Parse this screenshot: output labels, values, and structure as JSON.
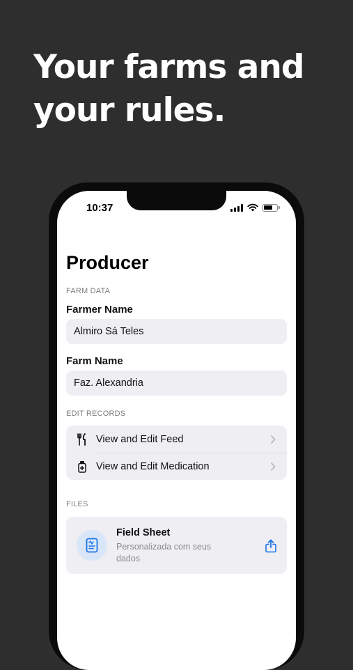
{
  "headline": {
    "line1": "Your farms and",
    "line2": "your rules."
  },
  "status_bar": {
    "time": "10:37"
  },
  "screen": {
    "title": "Producer",
    "farm_data": {
      "section_label": "FARM DATA",
      "farmer_name_label": "Farmer Name",
      "farmer_name_value": "Almiro Sá Teles",
      "farm_name_label": "Farm Name",
      "farm_name_value": "Faz. Alexandria"
    },
    "edit_records": {
      "section_label": "EDIT RECORDS",
      "items": [
        {
          "label": "View and Edit Feed",
          "icon": "fork-knife-icon"
        },
        {
          "label": "View and Edit Medication",
          "icon": "medicine-bottle-icon"
        }
      ]
    },
    "files": {
      "section_label": "FILES",
      "item": {
        "title": "Field Sheet",
        "subtitle": "Personalizada com seus dados",
        "icon": "document-icon",
        "action_icon": "share-icon"
      }
    }
  },
  "colors": {
    "accent": "#1a73e8",
    "background": "#2e2e2e",
    "field_bg": "#eeeef3"
  }
}
